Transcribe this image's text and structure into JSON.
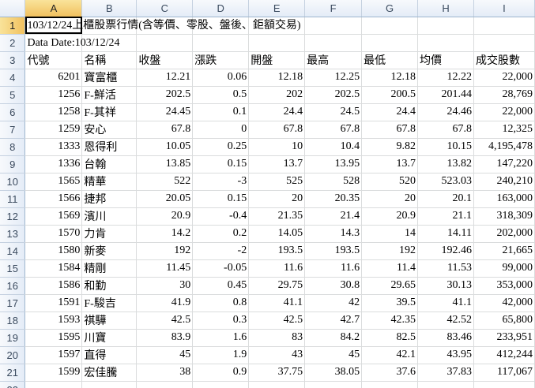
{
  "columns": [
    "A",
    "B",
    "C",
    "D",
    "E",
    "F",
    "G",
    "H",
    "I"
  ],
  "row_numbers": [
    1,
    2,
    3,
    4,
    5,
    6,
    7,
    8,
    9,
    10,
    11,
    12,
    13,
    14,
    15,
    16,
    17,
    18,
    19,
    20,
    21,
    22
  ],
  "title_cell": "103/12/24上櫃股票行情(含等價、零股、盤後、鉅額交易)",
  "date_cell": "Data Date:103/12/24",
  "headers": [
    "代號",
    "名稱",
    "收盤",
    "漲跌",
    "開盤",
    "最高",
    "最低",
    "均價",
    "成交股數"
  ],
  "rows": [
    [
      "6201",
      "寶富櫃",
      "12.21",
      "0.06",
      "12.18",
      "12.25",
      "12.18",
      "12.22",
      "22,000"
    ],
    [
      "1256",
      "F-鮮活",
      "202.5",
      "0.5",
      "202",
      "202.5",
      "200.5",
      "201.44",
      "28,769"
    ],
    [
      "1258",
      "F-其祥",
      "24.45",
      "0.1",
      "24.4",
      "24.5",
      "24.4",
      "24.46",
      "22,000"
    ],
    [
      "1259",
      "安心",
      "67.8",
      "0",
      "67.8",
      "67.8",
      "67.8",
      "67.8",
      "12,325"
    ],
    [
      "1333",
      "恩得利",
      "10.05",
      "0.25",
      "10",
      "10.4",
      "9.82",
      "10.15",
      "4,195,478"
    ],
    [
      "1336",
      "台翰",
      "13.85",
      "0.15",
      "13.7",
      "13.95",
      "13.7",
      "13.82",
      "147,220"
    ],
    [
      "1565",
      "精華",
      "522",
      "-3",
      "525",
      "528",
      "520",
      "523.03",
      "240,210"
    ],
    [
      "1566",
      "捷邦",
      "20.05",
      "0.15",
      "20",
      "20.35",
      "20",
      "20.1",
      "163,000"
    ],
    [
      "1569",
      "濱川",
      "20.9",
      "-0.4",
      "21.35",
      "21.4",
      "20.9",
      "21.1",
      "318,309"
    ],
    [
      "1570",
      "力肯",
      "14.2",
      "0.2",
      "14.05",
      "14.3",
      "14",
      "14.11",
      "202,000"
    ],
    [
      "1580",
      "新麥",
      "192",
      "-2",
      "193.5",
      "193.5",
      "192",
      "192.46",
      "21,665"
    ],
    [
      "1584",
      "精剛",
      "11.45",
      "-0.05",
      "11.6",
      "11.6",
      "11.4",
      "11.53",
      "99,000"
    ],
    [
      "1586",
      "和勤",
      "30",
      "0.45",
      "29.75",
      "30.8",
      "29.65",
      "30.13",
      "353,000"
    ],
    [
      "1591",
      "F-駿吉",
      "41.9",
      "0.8",
      "41.1",
      "42",
      "39.5",
      "41.1",
      "42,000"
    ],
    [
      "1593",
      "祺驊",
      "42.5",
      "0.3",
      "42.5",
      "42.7",
      "42.35",
      "42.52",
      "65,800"
    ],
    [
      "1595",
      "川寶",
      "83.9",
      "1.6",
      "83",
      "84.2",
      "82.5",
      "83.46",
      "233,951"
    ],
    [
      "1597",
      "直得",
      "45",
      "1.9",
      "43",
      "45",
      "42.1",
      "43.95",
      "412,244"
    ],
    [
      "1599",
      "宏佳騰",
      "38",
      "0.9",
      "37.75",
      "38.05",
      "37.6",
      "37.83",
      "117,067"
    ]
  ]
}
